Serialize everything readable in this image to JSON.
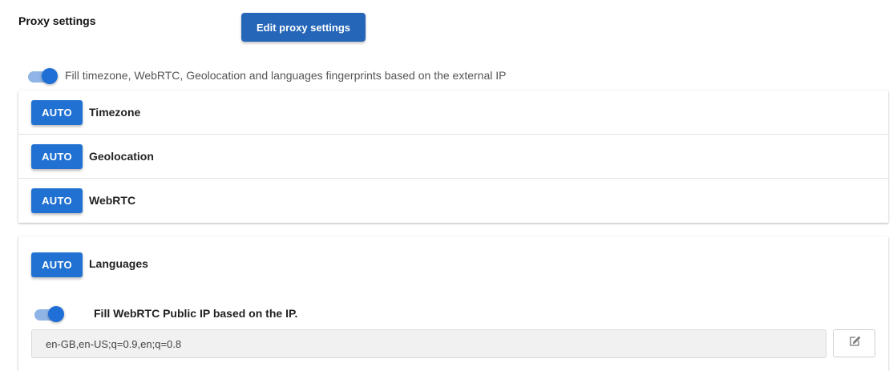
{
  "header": {
    "title": "Proxy settings",
    "edit_button_label": "Edit proxy settings"
  },
  "fingerprint_toggle": {
    "label": "Fill timezone, WebRTC, Geolocation and languages fingerprints based on the external IP",
    "enabled": true
  },
  "settings": [
    {
      "mode": "AUTO",
      "label": "Timezone"
    },
    {
      "mode": "AUTO",
      "label": "Geolocation"
    },
    {
      "mode": "AUTO",
      "label": "WebRTC"
    }
  ],
  "languages": {
    "mode": "AUTO",
    "label": "Languages",
    "webrtc_toggle_label": "Fill WebRTC Public IP based on the IP.",
    "webrtc_toggle_enabled": true,
    "value": "en-GB,en-US;q=0.9,en;q=0.8",
    "edit_icon": "edit-icon"
  },
  "colors": {
    "primary_button": "#2566b8",
    "auto_button": "#2071d2",
    "toggle_knob": "#1f6fd6",
    "toggle_track": "#8fb5e6"
  }
}
